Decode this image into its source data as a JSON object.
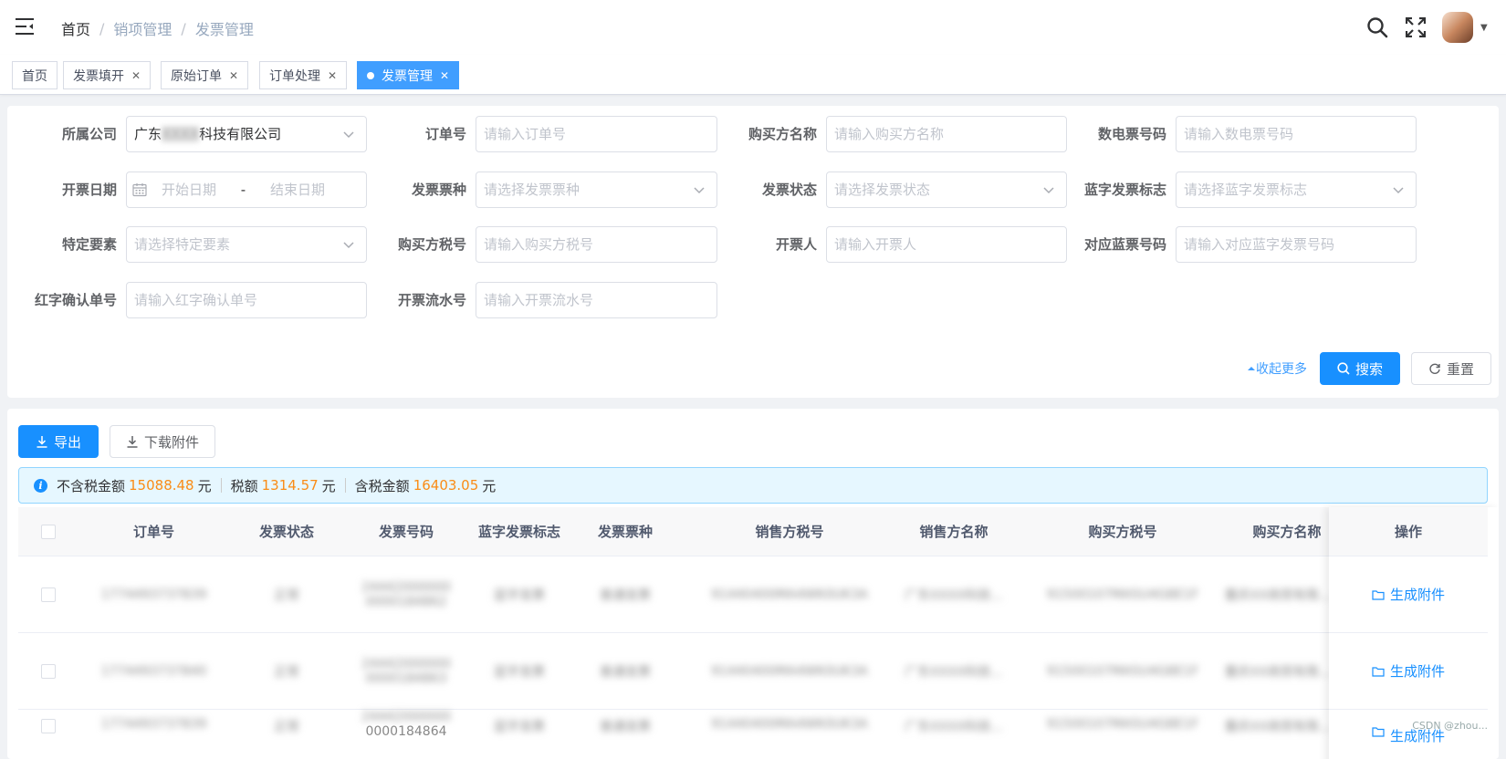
{
  "navbar": {
    "breadcrumb": [
      "首页",
      "销项管理",
      "发票管理"
    ]
  },
  "tags": [
    {
      "label": "首页",
      "closable": false,
      "active": false
    },
    {
      "label": "发票填开",
      "closable": true,
      "active": false
    },
    {
      "label": "原始订单",
      "closable": true,
      "active": false
    },
    {
      "label": "订单处理",
      "closable": true,
      "active": false
    },
    {
      "label": "发票管理",
      "closable": true,
      "active": true
    }
  ],
  "filters": {
    "company": {
      "label": "所属公司",
      "value_prefix": "广东",
      "value_blur": "XXXX",
      "value_suffix": "科技有限公司"
    },
    "order_no": {
      "label": "订单号",
      "placeholder": "请输入订单号"
    },
    "buyer_name": {
      "label": "购买方名称",
      "placeholder": "请输入购买方名称"
    },
    "einvoice_no": {
      "label": "数电票号码",
      "placeholder": "请输入数电票号码"
    },
    "invoice_date": {
      "label": "开票日期",
      "start_placeholder": "开始日期",
      "separator": "-",
      "end_placeholder": "结束日期"
    },
    "invoice_type": {
      "label": "发票票种",
      "placeholder": "请选择发票票种"
    },
    "invoice_status": {
      "label": "发票状态",
      "placeholder": "请选择发票状态"
    },
    "blue_flag": {
      "label": "蓝字发票标志",
      "placeholder": "请选择蓝字发票标志"
    },
    "special_element": {
      "label": "特定要素",
      "placeholder": "请选择特定要素"
    },
    "buyer_tax_no": {
      "label": "购买方税号",
      "placeholder": "请输入购买方税号"
    },
    "drawer": {
      "label": "开票人",
      "placeholder": "请输入开票人"
    },
    "related_blue_no": {
      "label": "对应蓝票号码",
      "placeholder": "请输入对应蓝字发票号码"
    },
    "red_confirm_no": {
      "label": "红字确认单号",
      "placeholder": "请输入红字确认单号"
    },
    "serial_no": {
      "label": "开票流水号",
      "placeholder": "请输入开票流水号"
    }
  },
  "search_actions": {
    "collapse_label": "收起更多",
    "search_label": "搜索",
    "reset_label": "重置"
  },
  "toolbar": {
    "export_label": "导出",
    "download_label": "下载附件"
  },
  "summary": {
    "excl_tax_label": "不含税金额",
    "excl_tax_value": "15088.48",
    "tax_label": "税额",
    "tax_value": "1314.57",
    "incl_tax_label": "含税金额",
    "incl_tax_value": "16403.05",
    "unit": "元"
  },
  "table": {
    "columns": [
      "订单号",
      "发票状态",
      "发票号码",
      "蓝字发票标志",
      "发票票种",
      "销售方税号",
      "销售方名称",
      "购买方税号",
      "购买方名称",
      "操作"
    ],
    "rows": [
      {
        "order_no": "1774493737839",
        "status": "正常",
        "invoice_no_1": "24442000000",
        "invoice_no_2": "0000184862",
        "blue_flag": "蓝字发票",
        "type": "普通发票",
        "seller_tax": "91440400MA4WK0UK3A",
        "seller_name": "广东XXXX科技...",
        "buyer_tax": "91500107MA5U4G8E1F",
        "buyer_name": "重庆XX商贸有限...",
        "op": "生成附件"
      },
      {
        "order_no": "1774493737840",
        "status": "正常",
        "invoice_no_1": "24442000000",
        "invoice_no_2": "0000184863",
        "blue_flag": "蓝字发票",
        "type": "普通发票",
        "seller_tax": "91440400MA4WK0UK3A",
        "seller_name": "广东XXXX科技...",
        "buyer_tax": "91500107MA5U4G8E1F",
        "buyer_name": "重庆XX商贸有限...",
        "op": "生成附件"
      },
      {
        "order_no": "1774493737839",
        "status": "正常",
        "invoice_no_1": "24442000000",
        "invoice_no_2": "0000184864",
        "blue_flag": "蓝字发票",
        "type": "普通发票",
        "seller_tax": "91440400MA4WK0UK3A",
        "seller_name": "广东XXXX科技...",
        "buyer_tax": "91500107MA5U4G8E1F",
        "buyer_name": "重庆XX商贸有限...",
        "op": "生成附件"
      }
    ]
  },
  "watermark": "CSDN @zhou..."
}
